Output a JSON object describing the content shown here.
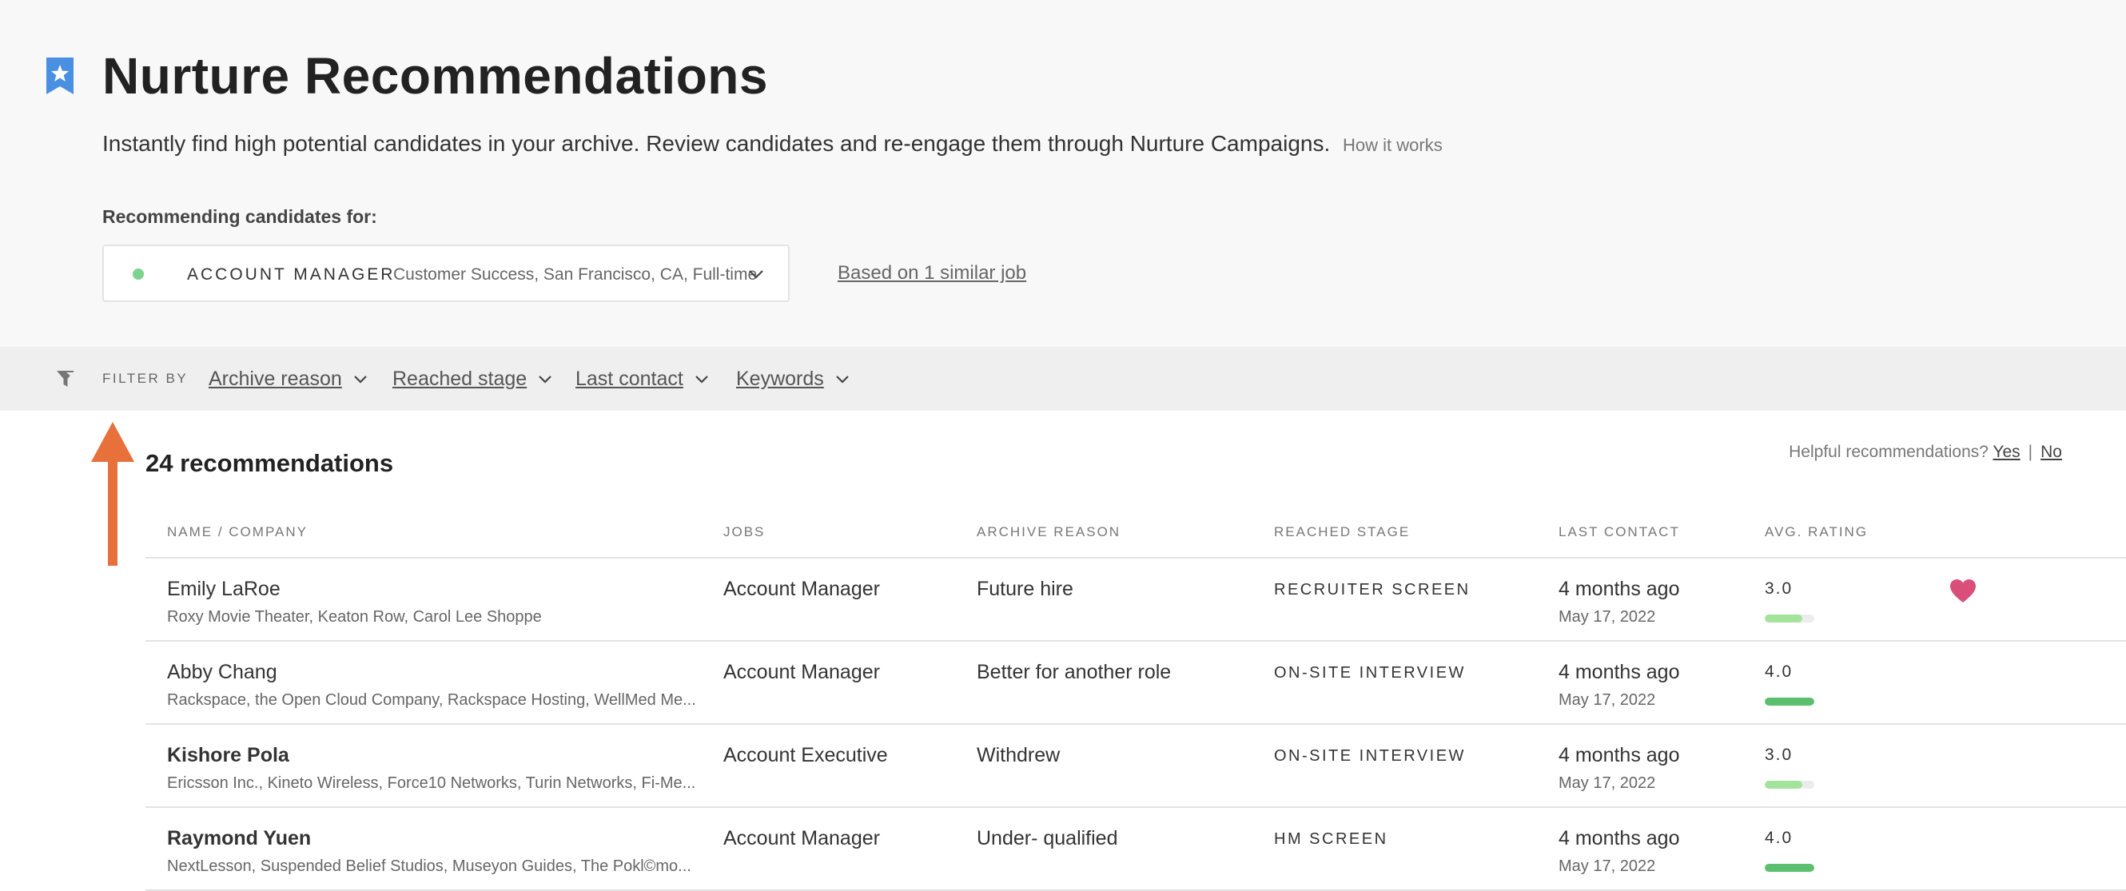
{
  "header": {
    "title": "Nurture Recommendations",
    "subtitle": "Instantly find high potential candidates in your archive. Review candidates and re-engage them through Nurture Campaigns.",
    "how_link": "How it works",
    "recommending_label": "Recommending candidates for:",
    "job": {
      "name": "ACCOUNT MANAGER",
      "details": "Customer Success, San Francisco, CA, Full-time"
    },
    "similar_link": "Based on 1 similar job"
  },
  "filters": {
    "label": "FILTER BY",
    "items": [
      "Archive reason",
      "Reached stage",
      "Last contact",
      "Keywords"
    ]
  },
  "results": {
    "count_label": "24 recommendations",
    "helpful_label": "Helpful recommendations?",
    "yes_label": "Yes",
    "separator": "|",
    "no_label": "No"
  },
  "table": {
    "columns": [
      "NAME / COMPANY",
      "JOBS",
      "ARCHIVE REASON",
      "REACHED STAGE",
      "LAST CONTACT",
      "AVG. RATING"
    ],
    "rows": [
      {
        "name": "Emily LaRoe",
        "bold": false,
        "companies": "Roxy Movie Theater, Keaton Row, Carol Lee Shoppe",
        "job": "Account Manager",
        "archive_reason": "Future hire",
        "reached_stage": "RECRUITER SCREEN",
        "last_contact": "4 months ago",
        "date": "May 17, 2022",
        "rating": "3.0",
        "rating_fraction": 0.75,
        "rating_color": "#a4e39b",
        "favorite": true
      },
      {
        "name": "Abby Chang",
        "bold": false,
        "companies": "Rackspace, the Open Cloud Company, Rackspace Hosting, WellMed Me...",
        "job": "Account Manager",
        "archive_reason": "Better for another role",
        "reached_stage": "ON-SITE INTERVIEW",
        "last_contact": "4 months ago",
        "date": "May 17, 2022",
        "rating": "4.0",
        "rating_fraction": 1.0,
        "rating_color": "#5cbf6d",
        "favorite": false
      },
      {
        "name": "Kishore Pola",
        "bold": true,
        "companies": "Ericsson Inc., Kineto Wireless, Force10 Networks, Turin Networks, Fi-Me...",
        "job": "Account Executive",
        "archive_reason": "Withdrew",
        "reached_stage": "ON-SITE INTERVIEW",
        "last_contact": "4 months ago",
        "date": "May 17, 2022",
        "rating": "3.0",
        "rating_fraction": 0.75,
        "rating_color": "#a4e39b",
        "favorite": false
      },
      {
        "name": "Raymond Yuen",
        "bold": true,
        "companies": "NextLesson, Suspended Belief Studios, Museyon Guides, The Pokl©mo...",
        "job": "Account Manager",
        "archive_reason": "Under- qualified",
        "reached_stage": "HM SCREEN",
        "last_contact": "4 months ago",
        "date": "May 17, 2022",
        "rating": "4.0",
        "rating_fraction": 1.0,
        "rating_color": "#5cbf6d",
        "favorite": false
      }
    ]
  },
  "colors": {
    "accent_blue": "#4a90e2",
    "arrow_orange": "#e8703a",
    "heart_pink": "#d94f79",
    "status_green": "#7ed38e"
  },
  "icons": [
    "bookmark-star-icon",
    "chevron-down-icon",
    "filter-icon",
    "arrow-up-icon",
    "heart-icon"
  ]
}
